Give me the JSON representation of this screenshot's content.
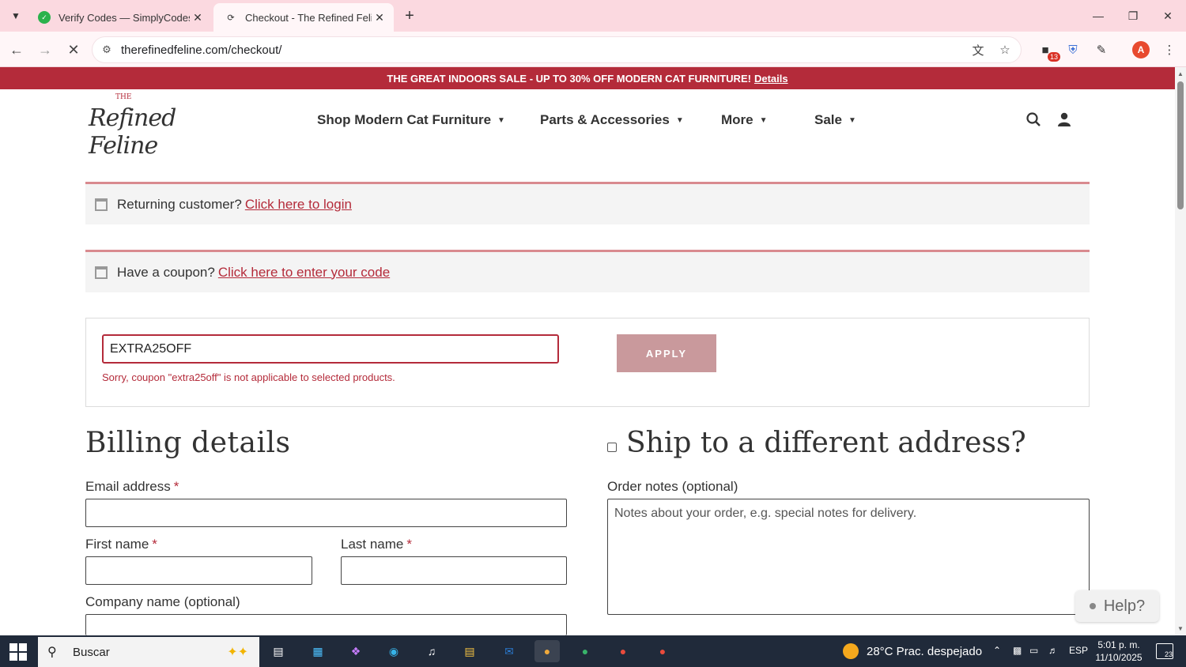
{
  "browser": {
    "tabs": [
      {
        "title": "Verify Codes — SimplyCodes",
        "icon": "simplycodes-favicon"
      },
      {
        "title": "Checkout - The Refined Feline",
        "icon": "loading-favicon"
      }
    ],
    "url": "therefinedfeline.com/checkout/",
    "extension_badge": "13",
    "profile_initial": "A"
  },
  "promo": {
    "text": "THE GREAT INDOORS SALE - UP TO 30% OFF MODERN CAT FURNITURE!",
    "link": "Details"
  },
  "header": {
    "logo_small": "THE",
    "logo_text": "Refined Feline",
    "nav": [
      {
        "label": "Shop Modern Cat Furniture"
      },
      {
        "label": "Parts & Accessories"
      },
      {
        "label": "More"
      },
      {
        "label": "Sale"
      }
    ]
  },
  "notices": {
    "returning": {
      "text": "Returning customer?",
      "link": "Click here to login"
    },
    "coupon": {
      "text": "Have a coupon?",
      "link": "Click here to enter your code"
    }
  },
  "coupon_form": {
    "value": "EXTRA25OFF",
    "apply_label": "APPLY",
    "error": "Sorry, coupon \"extra25off\" is not applicable to selected products."
  },
  "billing": {
    "heading": "Billing details",
    "email_label": "Email address",
    "first_name_label": "First name",
    "last_name_label": "Last name",
    "company_label": "Company name (optional)",
    "required_mark": "*"
  },
  "shipping": {
    "heading": "Ship to a different address?",
    "notes_label": "Order notes (optional)",
    "notes_placeholder": "Notes about your order, e.g. special notes for delivery."
  },
  "help": {
    "label": "Help?"
  },
  "taskbar": {
    "search_placeholder": "Buscar",
    "weather": "28°C  Prac. despejado",
    "language": "ESP",
    "time": "5:01 p. m.",
    "date": "11/10/2025",
    "notification_count": "23"
  },
  "colors": {
    "brand": "#b42b3a",
    "apply_button": "#c9999c",
    "tab_strip": "#fbd9e0"
  }
}
